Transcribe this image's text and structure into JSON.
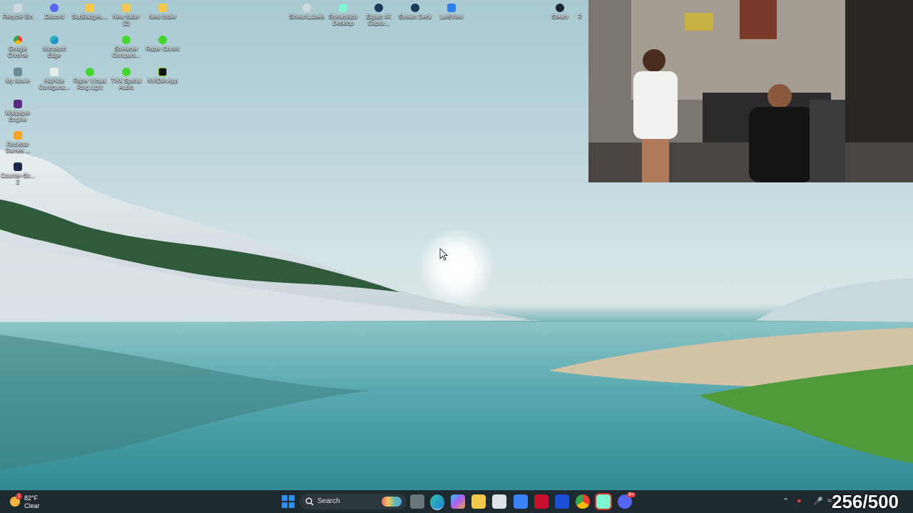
{
  "desktop_icons": {
    "recycle_bin": "Recycle Bin",
    "discord": "Discord",
    "subbadges": "SubBadges....",
    "new_folder_2_line1": "New folder",
    "new_folder_2_line2": "(2)",
    "new_folder": "New folder",
    "streamlabels": "StreamLabels",
    "streamlabs_desktop_line1": "Streamlabs",
    "streamlabs_desktop_line2": "Desktop",
    "elgato_line1": "Elgato 4K",
    "elgato_line2": "Captur...",
    "stream_deck": "Stream Deck",
    "letsview": "LetsView",
    "steam": "Steam",
    "partial_right": "R",
    "google_chrome_line1": "Google",
    "google_chrome_line2": "Chrome",
    "microsoft_edge_line1": "Microsoft",
    "microsoft_edge_line2": "Edge",
    "streamer_companion_line1": "Streamer",
    "streamer_companion_line2": "Compani...",
    "razer_cortex": "Razer Cortex",
    "my_movie": "My Movie",
    "hidhide_line1": "HidHide",
    "hidhide_line2": "Configurat...",
    "razer_ring_light_line1": "Razer Virtual",
    "razer_ring_light_line2": "Ring Light",
    "thx_line1": "THX Spatial",
    "thx_line2": "Audio",
    "nvidia_app": "NVIDIA App",
    "wallpaper_engine_line1": "Wallpaper",
    "wallpaper_engine_line2": "Engine",
    "rockstar_line1": "Rockstar",
    "rockstar_line2": "Games ...",
    "counter_strike_line1": "Counter-Str...",
    "counter_strike_line2": "2"
  },
  "taskbar": {
    "weather_temp": "82°F",
    "weather_desc": "Clear",
    "weather_badge": "1",
    "search_placeholder": "Search",
    "discord_badge": "9+",
    "overlay_counter": "256/500"
  },
  "colors": {
    "taskbar_bg": "#1f2a30",
    "windows_blue": "#2f8cf0",
    "discord": "#5865f2",
    "nvidia": "#76b900",
    "razer": "#44d62c"
  },
  "icons": [
    "recycle-bin-icon",
    "discord-icon",
    "chrome-icon",
    "edge-icon",
    "steam-icon",
    "windows-start-icon",
    "search-icon",
    "file-explorer-icon",
    "microsoft-store-icon",
    "mcafee-icon",
    "mic-icon",
    "wifi-icon",
    "chevron-up-icon"
  ]
}
